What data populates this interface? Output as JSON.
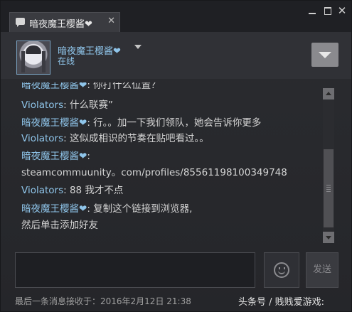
{
  "window": {
    "tab_title": "暗夜魔王樱酱❤",
    "tab_close": "✕",
    "close_glyph": "✕"
  },
  "header": {
    "friend_name": "暗夜魔王樱酱❤",
    "status": "在线"
  },
  "chat": {
    "messages": [
      {
        "sender": "暗夜魔王樱酱❤",
        "text": ": 你打什么位置？"
      },
      {
        "sender": "Violators",
        "text": ": 什么联赛”"
      },
      {
        "sender": "暗夜魔王樱酱❤",
        "text": ": 行。。加一下我们领队，她会告诉你更多"
      },
      {
        "sender": "Violators",
        "text": ": 这似成相识的节奏在贴吧看过。。"
      },
      {
        "sender": "暗夜魔王樱酱❤",
        "text": ":"
      },
      {
        "sender": "",
        "text": "steamcommuunity。com/profiles/85561198100349748"
      },
      {
        "sender": "Violators",
        "text": ": 88 我才不点"
      },
      {
        "sender": "暗夜魔王樱酱❤",
        "text": ": 复制这个链接到浏览器,"
      },
      {
        "sender": "",
        "text": "然后单击添加好友"
      }
    ]
  },
  "input": {
    "send_label": "发送"
  },
  "footer": {
    "last_message": "最后一条消息接收于：2016年2月12日 21:38",
    "watermark": "头条号 / 贱贱爱游戏:"
  },
  "colors": {
    "name": "#8fc5ea",
    "text": "#d4d4d4",
    "background": "#2b2c30"
  }
}
